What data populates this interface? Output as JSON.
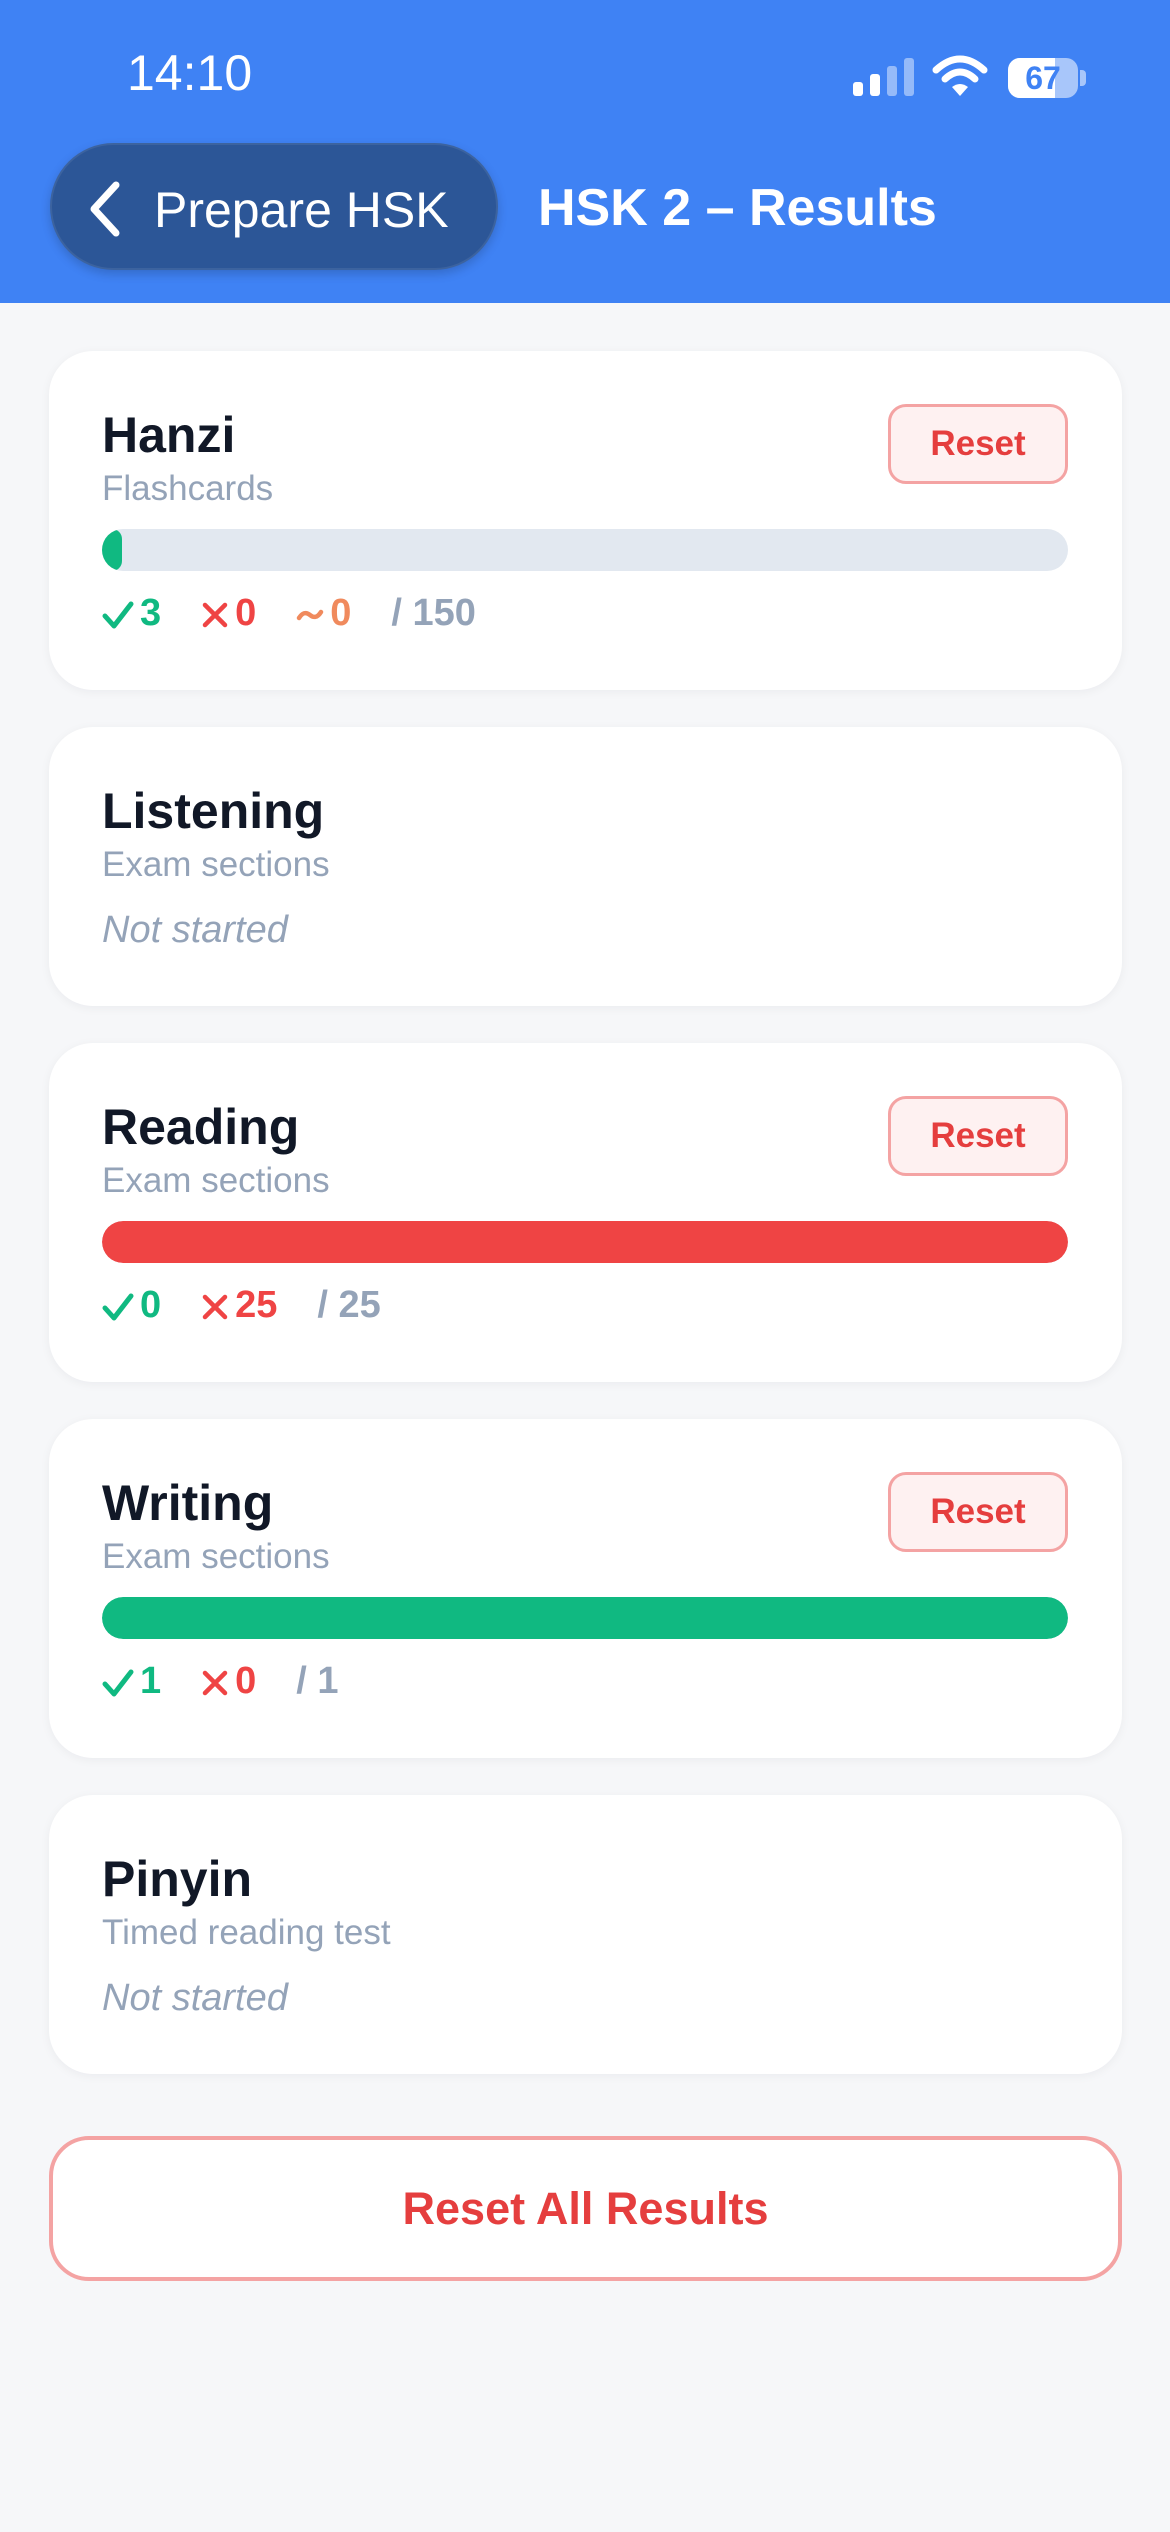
{
  "status_bar": {
    "time": "14:10",
    "battery": "67",
    "battery_level": 0.67
  },
  "header": {
    "back_label": "Prepare HSK",
    "title": "HSK 2 – Results"
  },
  "colors": {
    "header": "#3f82f4",
    "correct": "#10b981",
    "wrong": "#ef4444",
    "partial": "#f08a5d",
    "total": "#94a3b8"
  },
  "cards": {
    "hanzi": {
      "title": "Hanzi",
      "subtitle": "Flashcards",
      "reset_label": "Reset",
      "correct": "3",
      "wrong": "0",
      "partial": "0",
      "total": "/ 150",
      "progress": {
        "correct": 3,
        "wrong": 0,
        "total": 150
      }
    },
    "listening": {
      "title": "Listening",
      "subtitle": "Exam sections",
      "status": "Not started"
    },
    "reading": {
      "title": "Reading",
      "subtitle": "Exam sections",
      "reset_label": "Reset",
      "correct": "0",
      "wrong": "25",
      "total": "/ 25",
      "progress": {
        "correct": 0,
        "wrong": 25,
        "total": 25
      }
    },
    "writing": {
      "title": "Writing",
      "subtitle": "Exam sections",
      "reset_label": "Reset",
      "correct": "1",
      "wrong": "0",
      "total": "/ 1",
      "progress": {
        "correct": 1,
        "wrong": 0,
        "total": 1
      }
    },
    "pinyin": {
      "title": "Pinyin",
      "subtitle": "Timed reading test",
      "status": "Not started"
    }
  },
  "reset_all_label": "Reset All Results"
}
